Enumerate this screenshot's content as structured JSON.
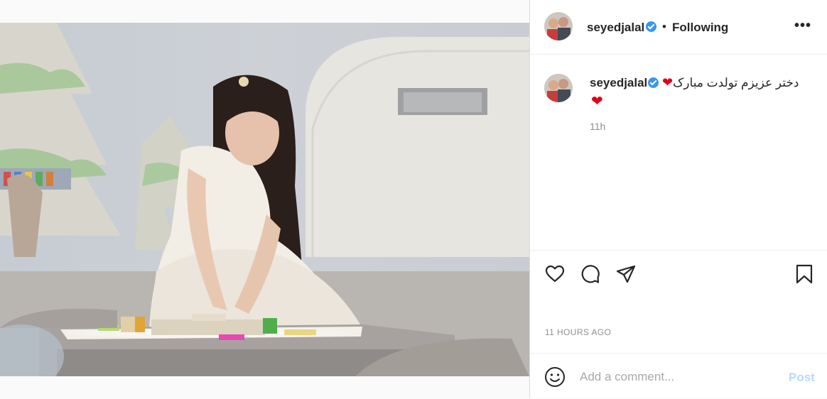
{
  "post": {
    "image_alt": "girl in white dress playing with letter blocks"
  },
  "header": {
    "username": "seyedjalal",
    "separator": "•",
    "follow_status": "Following",
    "more_label": "•••"
  },
  "caption": {
    "username": "seyedjalal",
    "text": "دختر عزیزم تولدت مبارک",
    "heart_emoji": "❤",
    "time": "11h"
  },
  "actions": {
    "icons": [
      "heart-icon",
      "comment-icon",
      "share-icon",
      "bookmark-icon"
    ],
    "timestamp": "11 HOURS AGO"
  },
  "comment_box": {
    "placeholder": "Add a comment...",
    "post_label": "Post"
  },
  "colors": {
    "verified": "#3897f0",
    "post_disabled": "#b3dbff",
    "heart": "#e0001b"
  }
}
